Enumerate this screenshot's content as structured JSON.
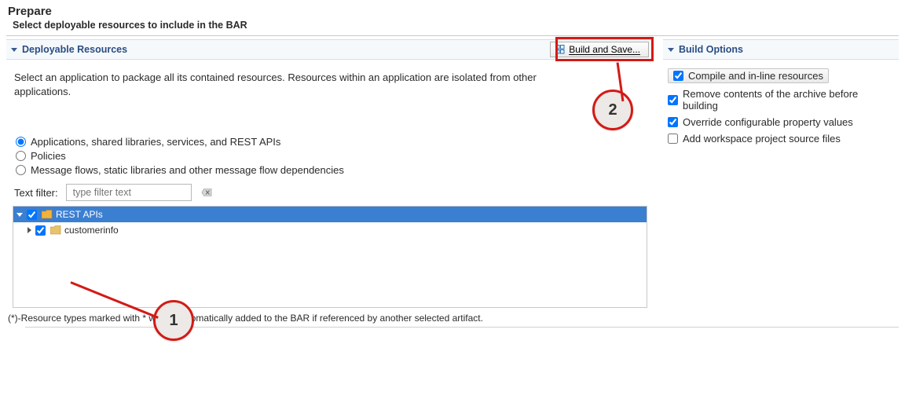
{
  "header": {
    "title": "Prepare",
    "subtitle": "Select deployable resources to include in the BAR"
  },
  "left": {
    "section_title": "Deployable Resources",
    "build_button_label": "Build and Save...",
    "desc": "Select an application to package all its contained resources. Resources within an application are isolated from other applications.",
    "scope_options": {
      "applications": "Applications, shared libraries, services, and REST APIs",
      "policies": "Policies",
      "message_flows": "Message flows, static libraries and other message flow dependencies"
    },
    "selected_scope": "applications",
    "filter": {
      "label": "Text filter:",
      "placeholder": "type filter text"
    },
    "tree": {
      "root_label": "REST APIs",
      "root_checked": true,
      "child_label": "customerinfo",
      "child_checked": true
    },
    "footnote": "(*)-Resource types marked with * will be automatically added to the BAR if referenced by another selected artifact."
  },
  "right": {
    "section_title": "Build Options",
    "options": {
      "compile": {
        "label": "Compile and in-line resources",
        "checked": true
      },
      "remove": {
        "label": "Remove contents of the archive before building",
        "checked": true
      },
      "override": {
        "label": "Override configurable property values",
        "checked": true
      },
      "workspace": {
        "label": "Add workspace project source files",
        "checked": false
      }
    }
  },
  "annotations": {
    "callout1": "1",
    "callout2": "2"
  }
}
